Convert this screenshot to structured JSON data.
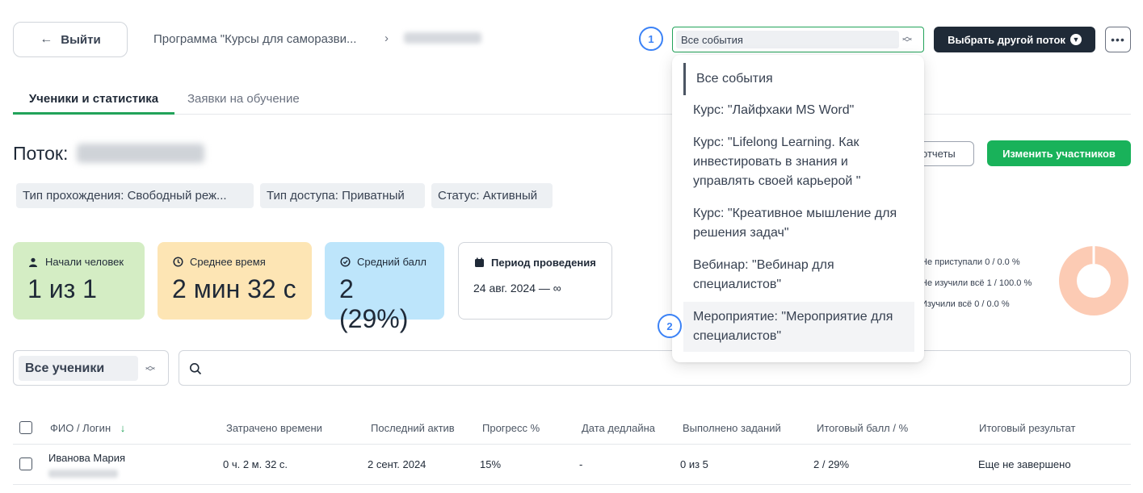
{
  "header": {
    "back_label": "Выйти",
    "breadcrumb_program": "Программа \"Курсы для саморазви...",
    "breadcrumb_sep": "›",
    "event_select_value": "Все события",
    "choose_flow_label": "Выбрать другой поток",
    "more_label": "•••",
    "badge_1": "1",
    "badge_2": "2"
  },
  "tabs": [
    {
      "label": "Ученики и статистика",
      "active": true
    },
    {
      "label": "Заявки на обучение",
      "active": false
    }
  ],
  "stream": {
    "title_prefix": "Поток:",
    "chips": [
      "Тип прохождения: Свободный реж...",
      "Тип доступа: Приватный",
      "Статус: Активный"
    ],
    "reports_label": "отчеты",
    "change_label": "Изменить участников"
  },
  "stats": [
    {
      "label": "Начали человек",
      "value": "1 из 1",
      "icon": "user-icon",
      "color": "#d4edc4"
    },
    {
      "label": "Среднее время",
      "value": "2 мин 32 с",
      "icon": "clock-icon",
      "color": "#fde5b4"
    },
    {
      "label": "Средний балл",
      "value": "2 (29%)",
      "icon": "score-icon",
      "color": "#bde5fb"
    },
    {
      "label": "Период проведения",
      "value": "24 авг. 2024 — ∞",
      "icon": "calendar-icon",
      "color": "#ffffff"
    }
  ],
  "progress_legend": [
    "Не приступали 0 / 0.0 %",
    "Не изучили всё 1 / 100.0 %",
    "Изучили всё 0 / 0.0 %"
  ],
  "filters": {
    "students_value": "Все ученики",
    "search_placeholder": ""
  },
  "table": {
    "columns": [
      "ФИО / Логин",
      "Затрачено времени",
      "Последний актив",
      "Прогресс %",
      "Дата дедлайна",
      "Выполнено заданий",
      "Итоговый балл / %",
      "Итоговый результат"
    ],
    "rows": [
      [
        "Иванова Мария",
        "0 ч. 2 м. 32 с.",
        "2 сент. 2024",
        "15%",
        "-",
        "0 из 5",
        "2 / 29%",
        "Еще не завершено"
      ]
    ]
  },
  "menu": {
    "options": [
      "Все события",
      "Курс: \"Лайфхаки MS Word\"",
      "Курс: \"Lifelong Learning. Как инвестировать в знания и управлять своей карьерой \"",
      "Курс: \"Креативное мышление для решения задач\"",
      "Вебинар: \"Вебинар для специалистов\"",
      "Мероприятие: \"Мероприятие для специалистов\""
    ]
  },
  "colors": {
    "accent_green": "#19b25a",
    "dark_button": "#1f2a37",
    "badge_blue": "#3b82f6",
    "donut": "#fccbb4"
  }
}
